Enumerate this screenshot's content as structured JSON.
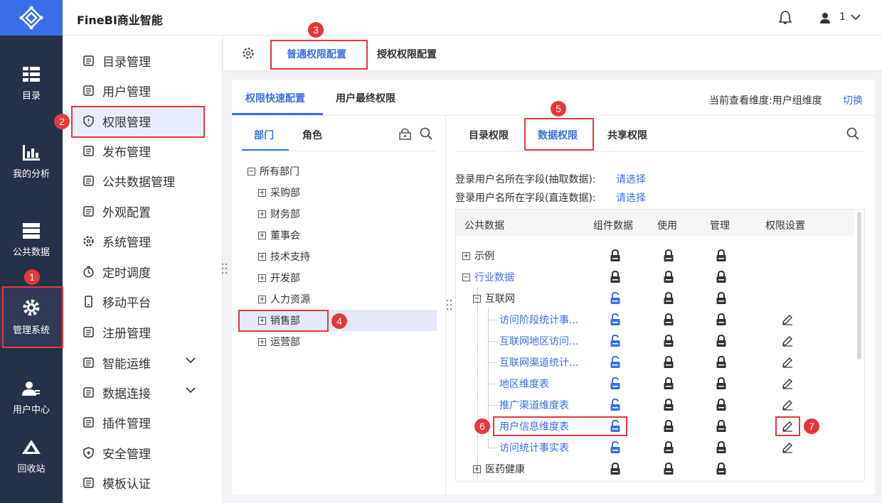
{
  "app": {
    "title": "FineBI商业智能",
    "user": "1"
  },
  "rail": [
    {
      "label": "目录",
      "icon": "catalog-icon"
    },
    {
      "label": "我的分析",
      "icon": "analysis-icon"
    },
    {
      "label": "公共数据",
      "icon": "public-data-icon"
    },
    {
      "label": "管理系统",
      "icon": "gear-icon"
    },
    {
      "label": "用户中心",
      "icon": "user-center-icon"
    },
    {
      "label": "回收站",
      "icon": "recycle-icon"
    }
  ],
  "nav": [
    {
      "label": "目录管理"
    },
    {
      "label": "用户管理"
    },
    {
      "label": "权限管理"
    },
    {
      "label": "发布管理"
    },
    {
      "label": "公共数据管理"
    },
    {
      "label": "外观配置"
    },
    {
      "label": "系统管理"
    },
    {
      "label": "定时调度"
    },
    {
      "label": "移动平台"
    },
    {
      "label": "注册管理"
    },
    {
      "label": "智能运维"
    },
    {
      "label": "数据连接"
    },
    {
      "label": "插件管理"
    },
    {
      "label": "安全管理"
    },
    {
      "label": "模板认证"
    }
  ],
  "top_tabs": {
    "normal": "普通权限配置",
    "grant": "授权权限配置"
  },
  "sub_tabs": {
    "quick": "权限快速配置",
    "final": "用户最终权限",
    "dimension": "当前查看维度:用户组维度",
    "switch": "切换"
  },
  "left_tabs": {
    "dept": "部门",
    "role": "角色"
  },
  "dept_tree": {
    "root": "所有部门",
    "children": [
      "采购部",
      "财务部",
      "董事会",
      "技术支持",
      "开发部",
      "人力资源",
      "销售部",
      "运营部"
    ]
  },
  "right_tabs": {
    "catalog": "目录权限",
    "data": "数据权限",
    "share": "共享权限"
  },
  "fields": {
    "extract_label": "登录用户名所在字段(抽取数据):",
    "direct_label": "登录用户名所在字段(直连数据):",
    "choose": "请选择"
  },
  "table": {
    "headers": [
      "公共数据",
      "组件数据",
      "使用",
      "管理",
      "权限设置"
    ],
    "rows": [
      {
        "name": "示例",
        "level": 0,
        "type": "collapsed"
      },
      {
        "name": "行业数据",
        "level": 0,
        "type": "expanded"
      },
      {
        "name": "互联网",
        "level": 1,
        "type": "expanded"
      },
      {
        "name": "访问阶段统计事...",
        "level": 2,
        "type": "leaf"
      },
      {
        "name": "互联网地区访问...",
        "level": 2,
        "type": "leaf"
      },
      {
        "name": "互联网渠道统计...",
        "level": 2,
        "type": "leaf"
      },
      {
        "name": "地区维度表",
        "level": 2,
        "type": "leaf"
      },
      {
        "name": "推广渠道维度表",
        "level": 2,
        "type": "leaf"
      },
      {
        "name": "用户信息维度表",
        "level": 2,
        "type": "leaf"
      },
      {
        "name": "访问统计事实表",
        "level": 2,
        "type": "leaf"
      },
      {
        "name": "医药健康",
        "level": 1,
        "type": "collapsed"
      }
    ]
  },
  "badges": [
    "1",
    "2",
    "3",
    "4",
    "5",
    "6",
    "7"
  ],
  "colors": {
    "accent": "#3a6ee8",
    "rail": "#253049",
    "highlight": "#e5383b"
  }
}
